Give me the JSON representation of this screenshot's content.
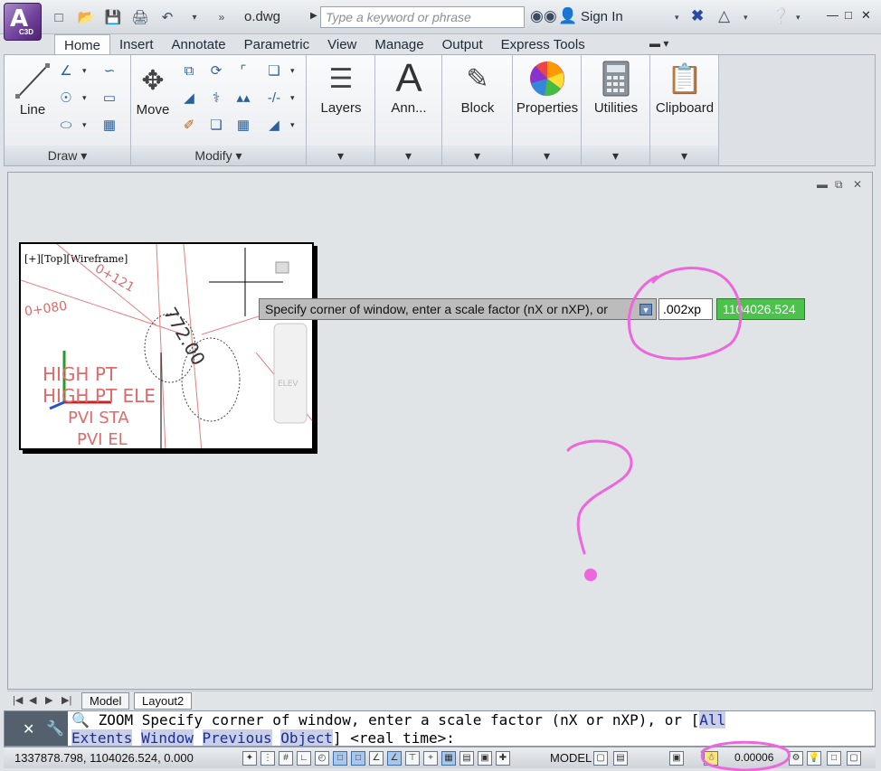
{
  "app": {
    "title": "o.dwg",
    "logo_text": "A",
    "logo_sub": "C3D"
  },
  "search": {
    "placeholder": "Type a keyword or phrase"
  },
  "signin_label": "Sign In",
  "tabs": [
    {
      "label": "Home",
      "active": true
    },
    {
      "label": "Insert"
    },
    {
      "label": "Annotate"
    },
    {
      "label": "Parametric"
    },
    {
      "label": "View"
    },
    {
      "label": "Manage"
    },
    {
      "label": "Output"
    },
    {
      "label": "Express Tools"
    }
  ],
  "ribbon": {
    "draw_panel": "Draw",
    "modify_panel": "Modify",
    "line_label": "Line",
    "move_label": "Move",
    "layers_label": "Layers",
    "annotation_label": "Ann...",
    "block_label": "Block",
    "properties_label": "Properties",
    "utilities_label": "Utilities",
    "clipboard_label": "Clipboard"
  },
  "viewport": {
    "label": "[+][Top][Wireframe]",
    "red_texts": [
      "HIGH PT",
      "HIGH PT ELE",
      "PVI STA",
      "PVI EL",
      "0+121",
      "0+080",
      "772.00",
      "ELEV"
    ]
  },
  "prompt": {
    "text": "Specify corner of window, enter a scale factor (nX or nXP), or",
    "input_value": ".002xp",
    "coord_value": "1104026.524"
  },
  "layout_tabs": {
    "model": "Model",
    "layout2": "Layout2"
  },
  "command": {
    "line1_prefix": "ZOOM",
    "line1_text": " Specify corner of window, enter a scale factor (nX or nXP), or [",
    "opt_all": "All",
    "opt_extents": "Extents",
    "opt_window": "Window",
    "opt_previous": "Previous",
    "opt_object": "Object",
    "line2_tail": "] <real time>:"
  },
  "status": {
    "coordinates": "1337878.798, 1104026.524, 0.000",
    "model_label": "MODEL",
    "scale_value": "0.00006"
  },
  "colors": {
    "accent": "#6d3f9a",
    "coord_green": "#4cc24c",
    "annotation_pink": "#ee66dd",
    "red_text": "#e06a6a"
  },
  "annotation_text": "?"
}
